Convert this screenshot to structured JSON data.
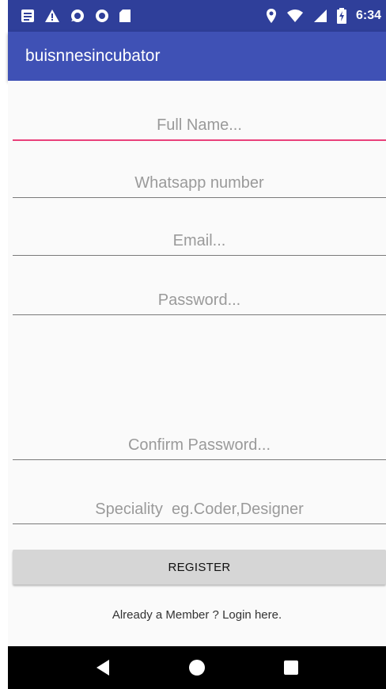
{
  "status_bar": {
    "time": "6:34",
    "left_icons": [
      "notes-icon",
      "warning-icon",
      "chat-icon",
      "record-icon",
      "sd-card-icon"
    ],
    "right_icons": [
      "location-icon",
      "wifi-icon",
      "signal-icon",
      "battery-charging-icon"
    ]
  },
  "app_bar": {
    "title": "buisnnesincubator"
  },
  "form": {
    "full_name": {
      "placeholder": "Full Name..."
    },
    "whatsapp": {
      "placeholder": "Whatsapp number"
    },
    "email": {
      "placeholder": "Email..."
    },
    "password": {
      "placeholder": "Password..."
    },
    "confirm_password": {
      "placeholder": "Confirm Password..."
    },
    "speciality": {
      "placeholder": "Speciality  eg.Coder,Designer"
    },
    "register_label": "REGISTER",
    "login_link": "Already a Member ? Login here."
  },
  "nav_bar": {
    "buttons": [
      "back-icon",
      "home-icon",
      "recents-icon"
    ]
  },
  "colors": {
    "status_bar": "#2f3f9a",
    "app_bar": "#3f51b5",
    "accent": "#e9407a",
    "background": "#fafafa",
    "button": "#d6d6d6"
  }
}
